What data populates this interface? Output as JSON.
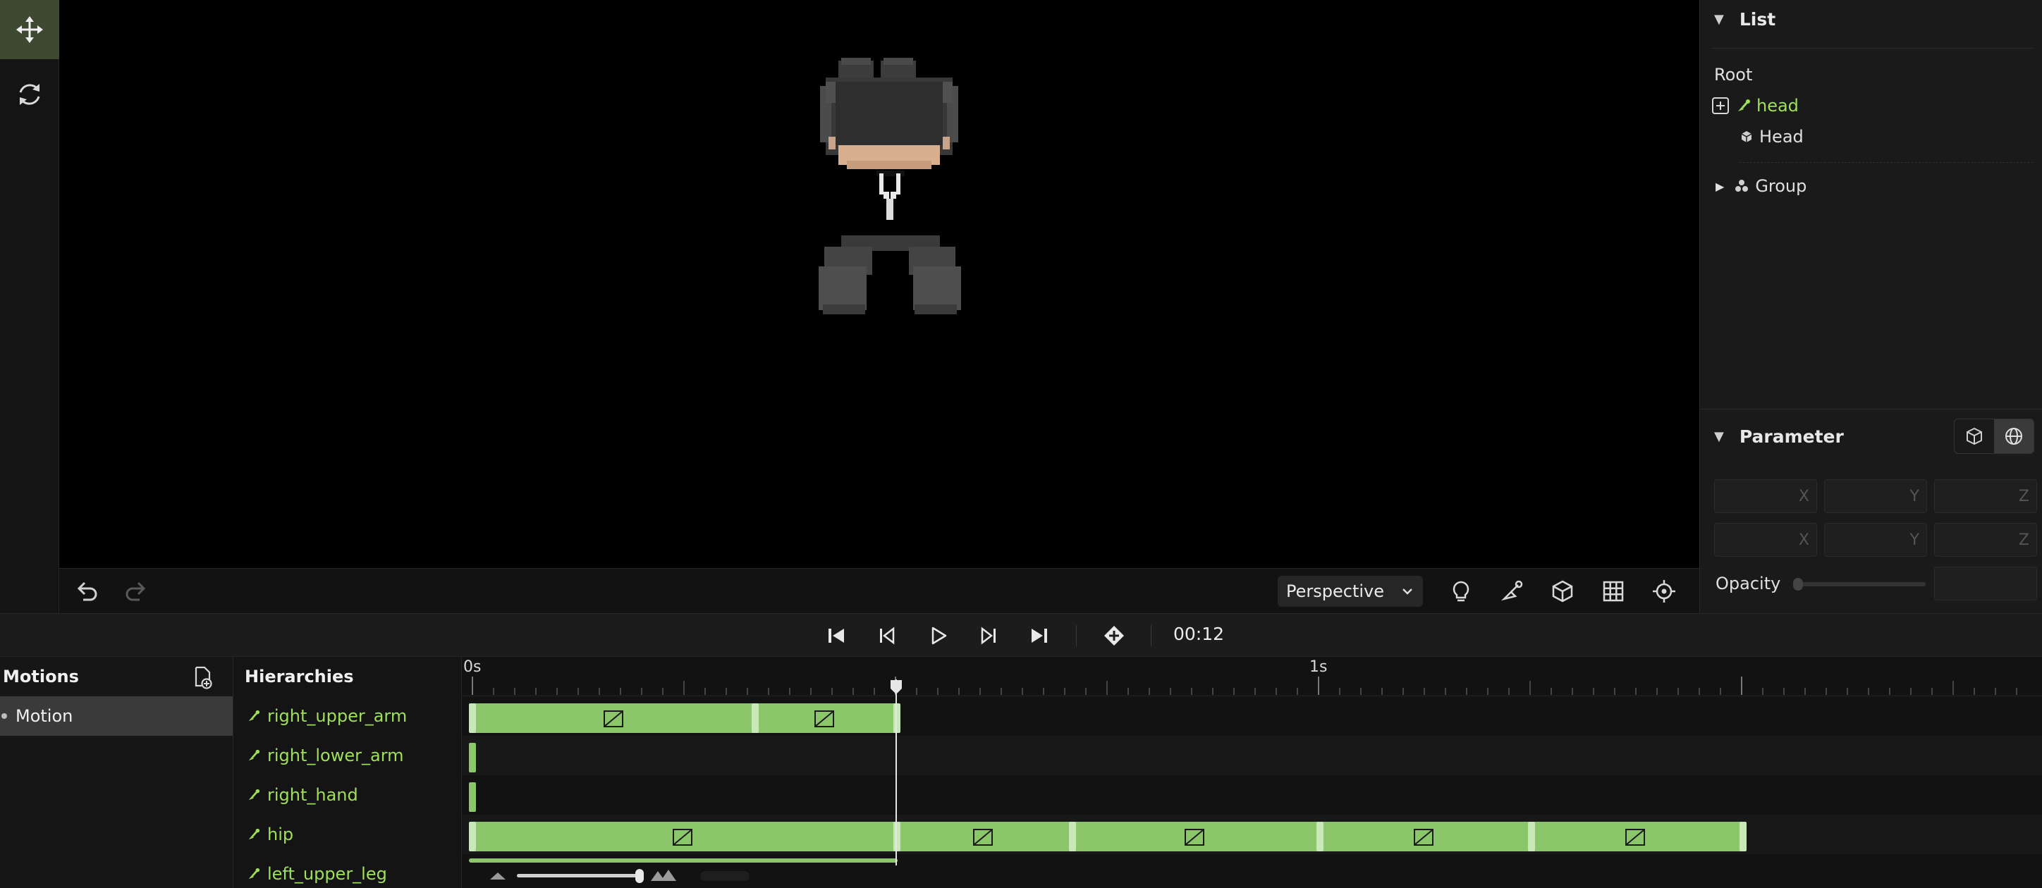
{
  "toolbar": {
    "tools": [
      "move-icon",
      "rotate-icon"
    ]
  },
  "viewport": {
    "camera_select": "Perspective",
    "undo_icon": "undo-icon",
    "redo_icon": "redo-icon",
    "tools": [
      "lightbulb-icon",
      "bone-pen-icon",
      "cube-icon",
      "grid-icon",
      "target-icon"
    ]
  },
  "list_panel": {
    "title": "List",
    "root_label": "Root",
    "items": [
      {
        "label": "head",
        "icon": "bone-icon",
        "selected": true
      },
      {
        "label": "Head",
        "icon": "mesh-icon"
      },
      {
        "label": "Group",
        "icon": "group-icon",
        "collapsed": true
      }
    ]
  },
  "parameter_panel": {
    "title": "Parameter",
    "position_axes": [
      "X",
      "Y",
      "Z"
    ],
    "rotation_axes": [
      "X",
      "Y",
      "Z"
    ],
    "opacity_label": "Opacity",
    "opacity_value": 0
  },
  "transport": {
    "current_time": "00:12",
    "buttons": [
      "skip-to-start-icon",
      "step-back-icon",
      "play-icon",
      "step-forward-icon",
      "skip-to-end-icon",
      "add-keyframe-icon"
    ]
  },
  "motions": {
    "title": "Motions",
    "items": [
      {
        "label": "Motion",
        "selected": true
      }
    ]
  },
  "hierarchies": {
    "title": "Hierarchies",
    "bones": [
      "right_upper_arm",
      "right_lower_arm",
      "right_hand",
      "hip",
      "left_upper_leg"
    ]
  },
  "timeline": {
    "ruler_labels": [
      "0s",
      "1s"
    ],
    "playhead_time": "00:12",
    "zoom_level": 0.68
  },
  "colors": {
    "accent_green": "#9fe05a",
    "keyframe_bar": "#8bc76a",
    "keyframe_handle": "#c8e9b7",
    "active_tool_bg": "#3d4a31"
  }
}
